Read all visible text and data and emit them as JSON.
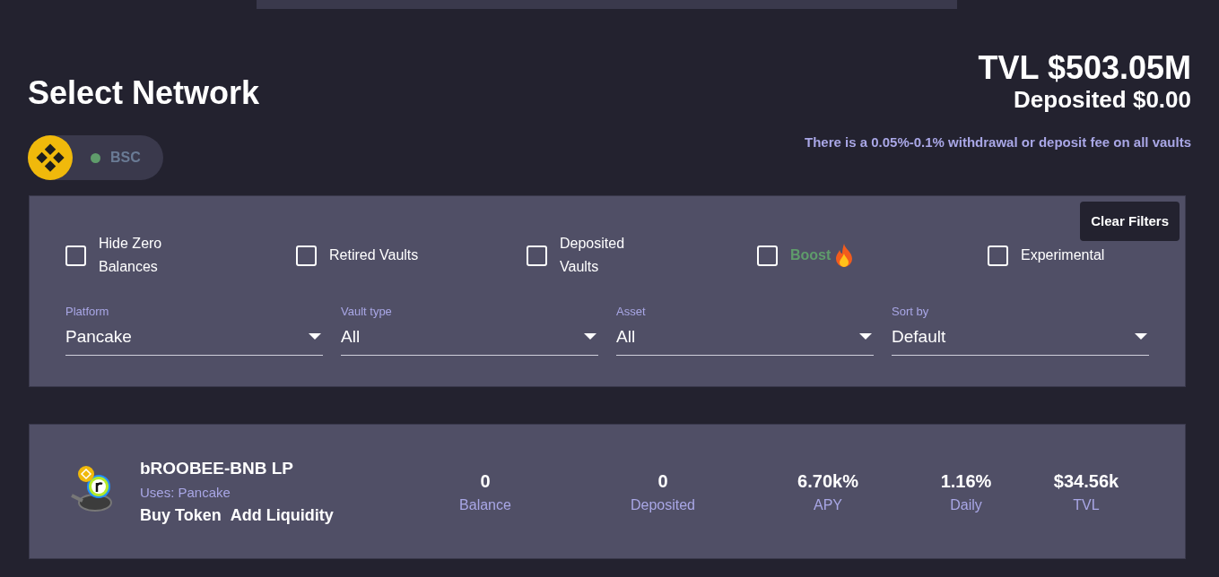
{
  "header": {
    "title": "Select Network",
    "tvl": "TVL $503.05M",
    "deposited": "Deposited $0.00",
    "fee_note": "There is a 0.05%-0.1% withdrawal or deposit fee on all vaults"
  },
  "network": {
    "label": "BSC",
    "color": "#5f9c6b",
    "selected": false
  },
  "filters": {
    "clear_button": "Clear Filters",
    "checkboxes": [
      {
        "label": "Hide Zero Balances",
        "kind": "plain",
        "checked": false
      },
      {
        "label": "Retired Vaults",
        "kind": "plain",
        "checked": false
      },
      {
        "label": "Deposited Vaults",
        "kind": "plain",
        "checked": false
      },
      {
        "label": "Boost",
        "kind": "boost",
        "checked": false
      },
      {
        "label": "Experimental",
        "kind": "plain",
        "checked": false
      }
    ],
    "selects": [
      {
        "label": "Platform",
        "value": "Pancake"
      },
      {
        "label": "Vault type",
        "value": "All"
      },
      {
        "label": "Asset",
        "value": "All"
      },
      {
        "label": "Sort by",
        "value": "Default"
      }
    ]
  },
  "vaults": [
    {
      "name": "bROOBEE-BNB LP",
      "uses": "Uses: Pancake",
      "links": [
        "Buy Token",
        "Add Liquidity"
      ],
      "stats": [
        {
          "value": "0",
          "label": "Balance"
        },
        {
          "value": "0",
          "label": "Deposited"
        },
        {
          "value": "6.70k%",
          "label": "APY"
        },
        {
          "value": "1.16%",
          "label": "Daily"
        },
        {
          "value": "$34.56k",
          "label": "TVL"
        }
      ]
    }
  ]
}
